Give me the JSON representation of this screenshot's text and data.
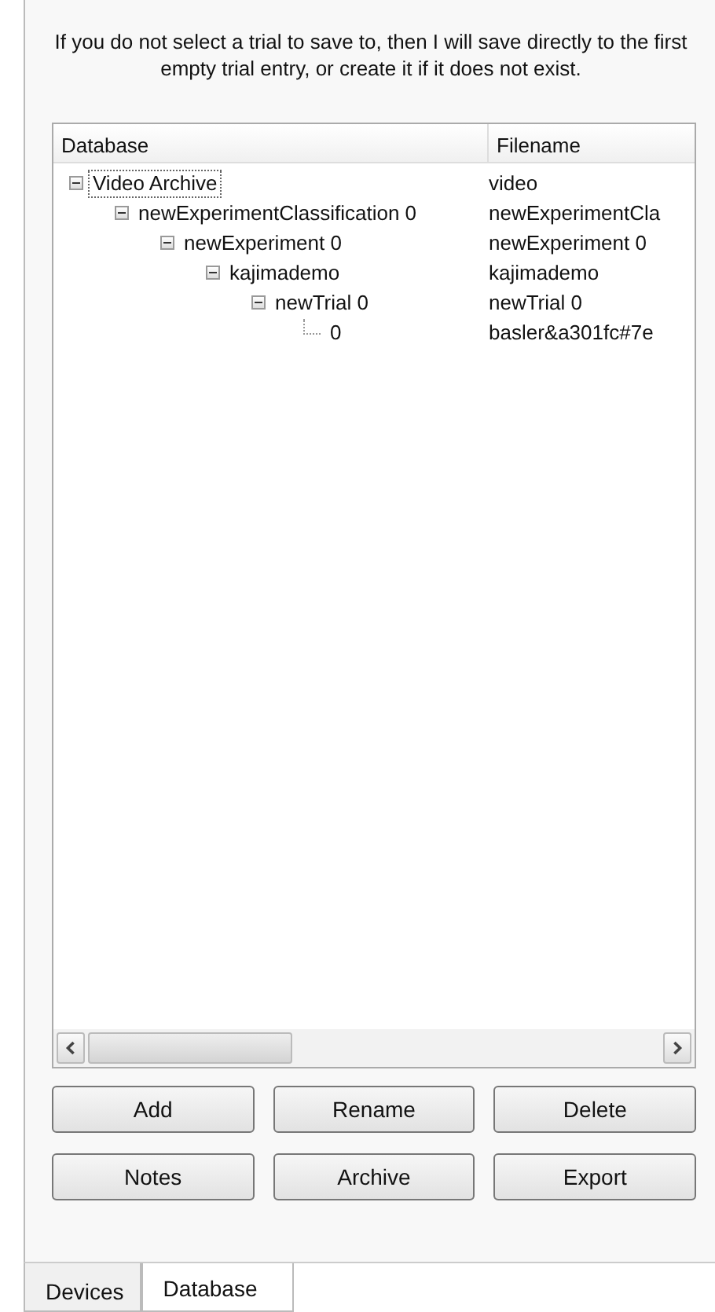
{
  "message": "If you do not select a trial to save to, then I will save directly to the first empty trial entry, or create it if it does not exist.",
  "list": {
    "columns": [
      "Database",
      "Filename"
    ],
    "tree": [
      {
        "name": "Video Archive",
        "filename": "video",
        "selected": true,
        "expanded": true,
        "children": [
          {
            "name": "newExperimentClassification 0",
            "filename": "newExperimentCla",
            "selected": false,
            "expanded": true,
            "children": [
              {
                "name": "newExperiment 0",
                "filename": "newExperiment 0",
                "selected": false,
                "expanded": true,
                "children": [
                  {
                    "name": "kajimademo",
                    "filename": "kajimademo",
                    "selected": false,
                    "expanded": true,
                    "children": [
                      {
                        "name": "newTrial 0",
                        "filename": "newTrial 0",
                        "selected": false,
                        "expanded": true,
                        "children": [
                          {
                            "name": "0",
                            "filename": "basler&a301fc#7e",
                            "selected": false
                          }
                        ]
                      }
                    ]
                  }
                ]
              }
            ]
          }
        ]
      }
    ]
  },
  "buttons": [
    "Add",
    "Rename",
    "Delete",
    "Notes",
    "Archive",
    "Export"
  ],
  "tabs": [
    {
      "label": "Devices",
      "selected": false
    },
    {
      "label": "Database",
      "selected": true
    }
  ]
}
